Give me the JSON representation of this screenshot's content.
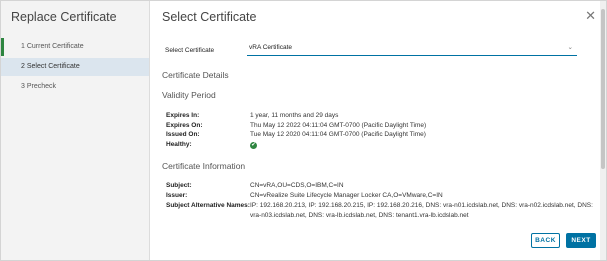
{
  "wizard": {
    "title": "Replace Certificate",
    "steps": [
      {
        "label": "1  Current Certificate",
        "state": "completed"
      },
      {
        "label": "2  Select Certificate",
        "state": "active"
      },
      {
        "label": "3  Precheck",
        "state": "pending"
      }
    ]
  },
  "page": {
    "title": "Select Certificate",
    "select": {
      "label": "Select Certificate",
      "value": "vRA Certificate"
    },
    "details_title": "Certificate Details",
    "validity": {
      "title": "Validity Period",
      "expires_in_label": "Expires In:",
      "expires_in": "1 year, 11 months and 29 days",
      "expires_on_label": "Expires On:",
      "expires_on": "Thu May 12 2022 04:11:04 GMT-0700 (Pacific Daylight Time)",
      "issued_on_label": "Issued On:",
      "issued_on": "Tue May 12 2020 04:11:04 GMT-0700 (Pacific Daylight Time)",
      "healthy_label": "Healthy:",
      "healthy_mark": "✔"
    },
    "info": {
      "title": "Certificate Information",
      "subject_label": "Subject:",
      "subject": "CN=vRA,OU=CDS,O=IBM,C=IN",
      "issuer_label": "Issuer:",
      "issuer": "CN=vRealize Suite Lifecycle Manager Locker CA,O=VMware,C=IN",
      "san_label": "Subject Alternative Names:",
      "san": "IP: 192.168.20.213, IP: 192.168.20.215, IP: 192.168.20.216, DNS: vra-n01.icdslab.net, DNS: vra-n02.icdslab.net, DNS: vra-n03.icdslab.net, DNS: vra-lb.icdslab.net, DNS: tenant1.vra-lb.icdslab.net"
    }
  },
  "buttons": {
    "back": "BACK",
    "next": "NEXT"
  },
  "colors": {
    "accent": "#0072a3",
    "success": "#2e8540",
    "sidebar_bg": "#f3f3f3",
    "active_step_bg": "#dbe5ee"
  }
}
